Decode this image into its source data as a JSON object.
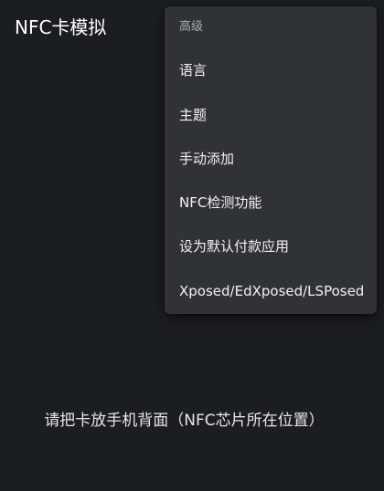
{
  "app_bar": {
    "title": "NFC卡模拟"
  },
  "main": {
    "hint": "请把卡放手机背面（NFC芯片所在位置）"
  },
  "menu": {
    "header": "高级",
    "items": [
      {
        "label": "语言"
      },
      {
        "label": "主题"
      },
      {
        "label": "手动添加"
      },
      {
        "label": "NFC检测功能"
      },
      {
        "label": "设为默认付款应用"
      },
      {
        "label": "Xposed/EdXposed/LSPosed"
      }
    ]
  },
  "colors": {
    "background": "#1b1e21",
    "menu_background": "#303336",
    "menu_header_text": "#a9adb1",
    "text_primary": "#ffffff"
  }
}
